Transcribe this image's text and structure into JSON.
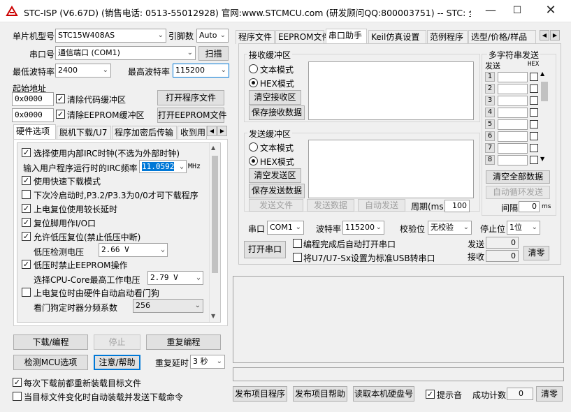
{
  "title": "STC-ISP (V6.67D) (销售电话: 0513-55012928) 官网:www.STCMCU.com  (研发顾问QQ:800003751)  -- STC: 全球...",
  "mcu": {
    "label": "单片机型号",
    "value": "STC15W408AS",
    "pins_label": "引脚数",
    "pins_value": "Auto"
  },
  "port": {
    "label": "串口号",
    "value": "通信端口 (COM1)",
    "scan": "扫描"
  },
  "baud": {
    "min_label": "最低波特率",
    "min": "2400",
    "max_label": "最高波特率",
    "max": "115200"
  },
  "addr": {
    "label": "起始地址",
    "a1": "0x0000",
    "c1": "清除代码缓冲区",
    "b1": "打开程序文件",
    "a2": "0x0000",
    "c2": "清除EEPROM缓冲区",
    "b2": "打开EEPROM文件"
  },
  "left_tabs": [
    "硬件选项",
    "脱机下载/U7",
    "程序加密后传输",
    "收到用"
  ],
  "hw": {
    "o1": "选择使用内部IRC时钟(不选为外部时钟)",
    "freq_label": "输入用户程序运行时的IRC频率",
    "freq": "11.0592",
    "mhz": "MHz",
    "o2": "使用快速下载模式",
    "o3": "下次冷启动时,P3.2/P3.3为0/0才可下载程序",
    "o4": "上电复位使用较长延时",
    "o5": "复位脚用作I/O口",
    "o6": "允许低压复位(禁止低压中断)",
    "lv_label": "低压检测电压",
    "lv": "2.66 V",
    "o7": "低压时禁止EEPROM操作",
    "cpu_label": "选择CPU-Core最高工作电压",
    "cpu": "2.79 V",
    "o8": "上电复位时由硬件自动启动看门狗",
    "wd_label": "看门狗定时器分频系数",
    "wd": "256"
  },
  "bottom_left": {
    "download": "下载/编程",
    "stop": "停止",
    "reprog": "重复编程",
    "detect": "检测MCU选项",
    "help": "注意/帮助",
    "delay_label": "重复延时",
    "delay": "3 秒",
    "cb1": "每次下载前都重新装载目标文件",
    "cb2": "当目标文件变化时自动装载并发送下载命令"
  },
  "right_tabs": [
    "程序文件",
    "EEPROM文件",
    "串口助手",
    "Keil仿真设置",
    "范例程序",
    "选型/价格/样品"
  ],
  "serial": {
    "recv_title": "接收缓冲区",
    "text_mode": "文本模式",
    "hex_mode": "HEX模式",
    "clear_recv": "清空接收区",
    "save_recv": "保存接收数据",
    "send_title": "发送缓冲区",
    "clear_send": "清空发送区",
    "save_send": "保存发送数据",
    "send_file": "发送文件",
    "send_data": "发送数据",
    "auto_send": "自动发送",
    "period_label": "周期(ms)",
    "period": "100",
    "multi_title": "多字符串发送",
    "col_send": "发送",
    "col_hex": "HEX",
    "rows": [
      "1",
      "2",
      "3",
      "4",
      "5",
      "6",
      "7",
      "8"
    ],
    "clear_all": "清空全部数据",
    "auto_loop": "自动循环发送",
    "interval_label": "间隔",
    "interval": "0",
    "ms": "ms",
    "port_label": "串口",
    "port": "COM1",
    "baud_label": "波特率",
    "baud": "115200",
    "parity_label": "校验位",
    "parity": "无校验",
    "stop_label": "停止位",
    "stop": "1位",
    "open": "打开串口",
    "cbA": "编程完成后自动打开串口",
    "cbB": "将U7/U7-Sx设置为标准USB转串口",
    "sent_label": "发送",
    "sent": "0",
    "recv_label": "接收",
    "recv": "0",
    "clear": "清零"
  },
  "footer": {
    "publish": "发布项目程序",
    "publish_help": "发布项目帮助",
    "read_disk": "读取本机硬盘号",
    "tone": "提示音",
    "count_label": "成功计数",
    "count": "0",
    "clear": "清零"
  }
}
